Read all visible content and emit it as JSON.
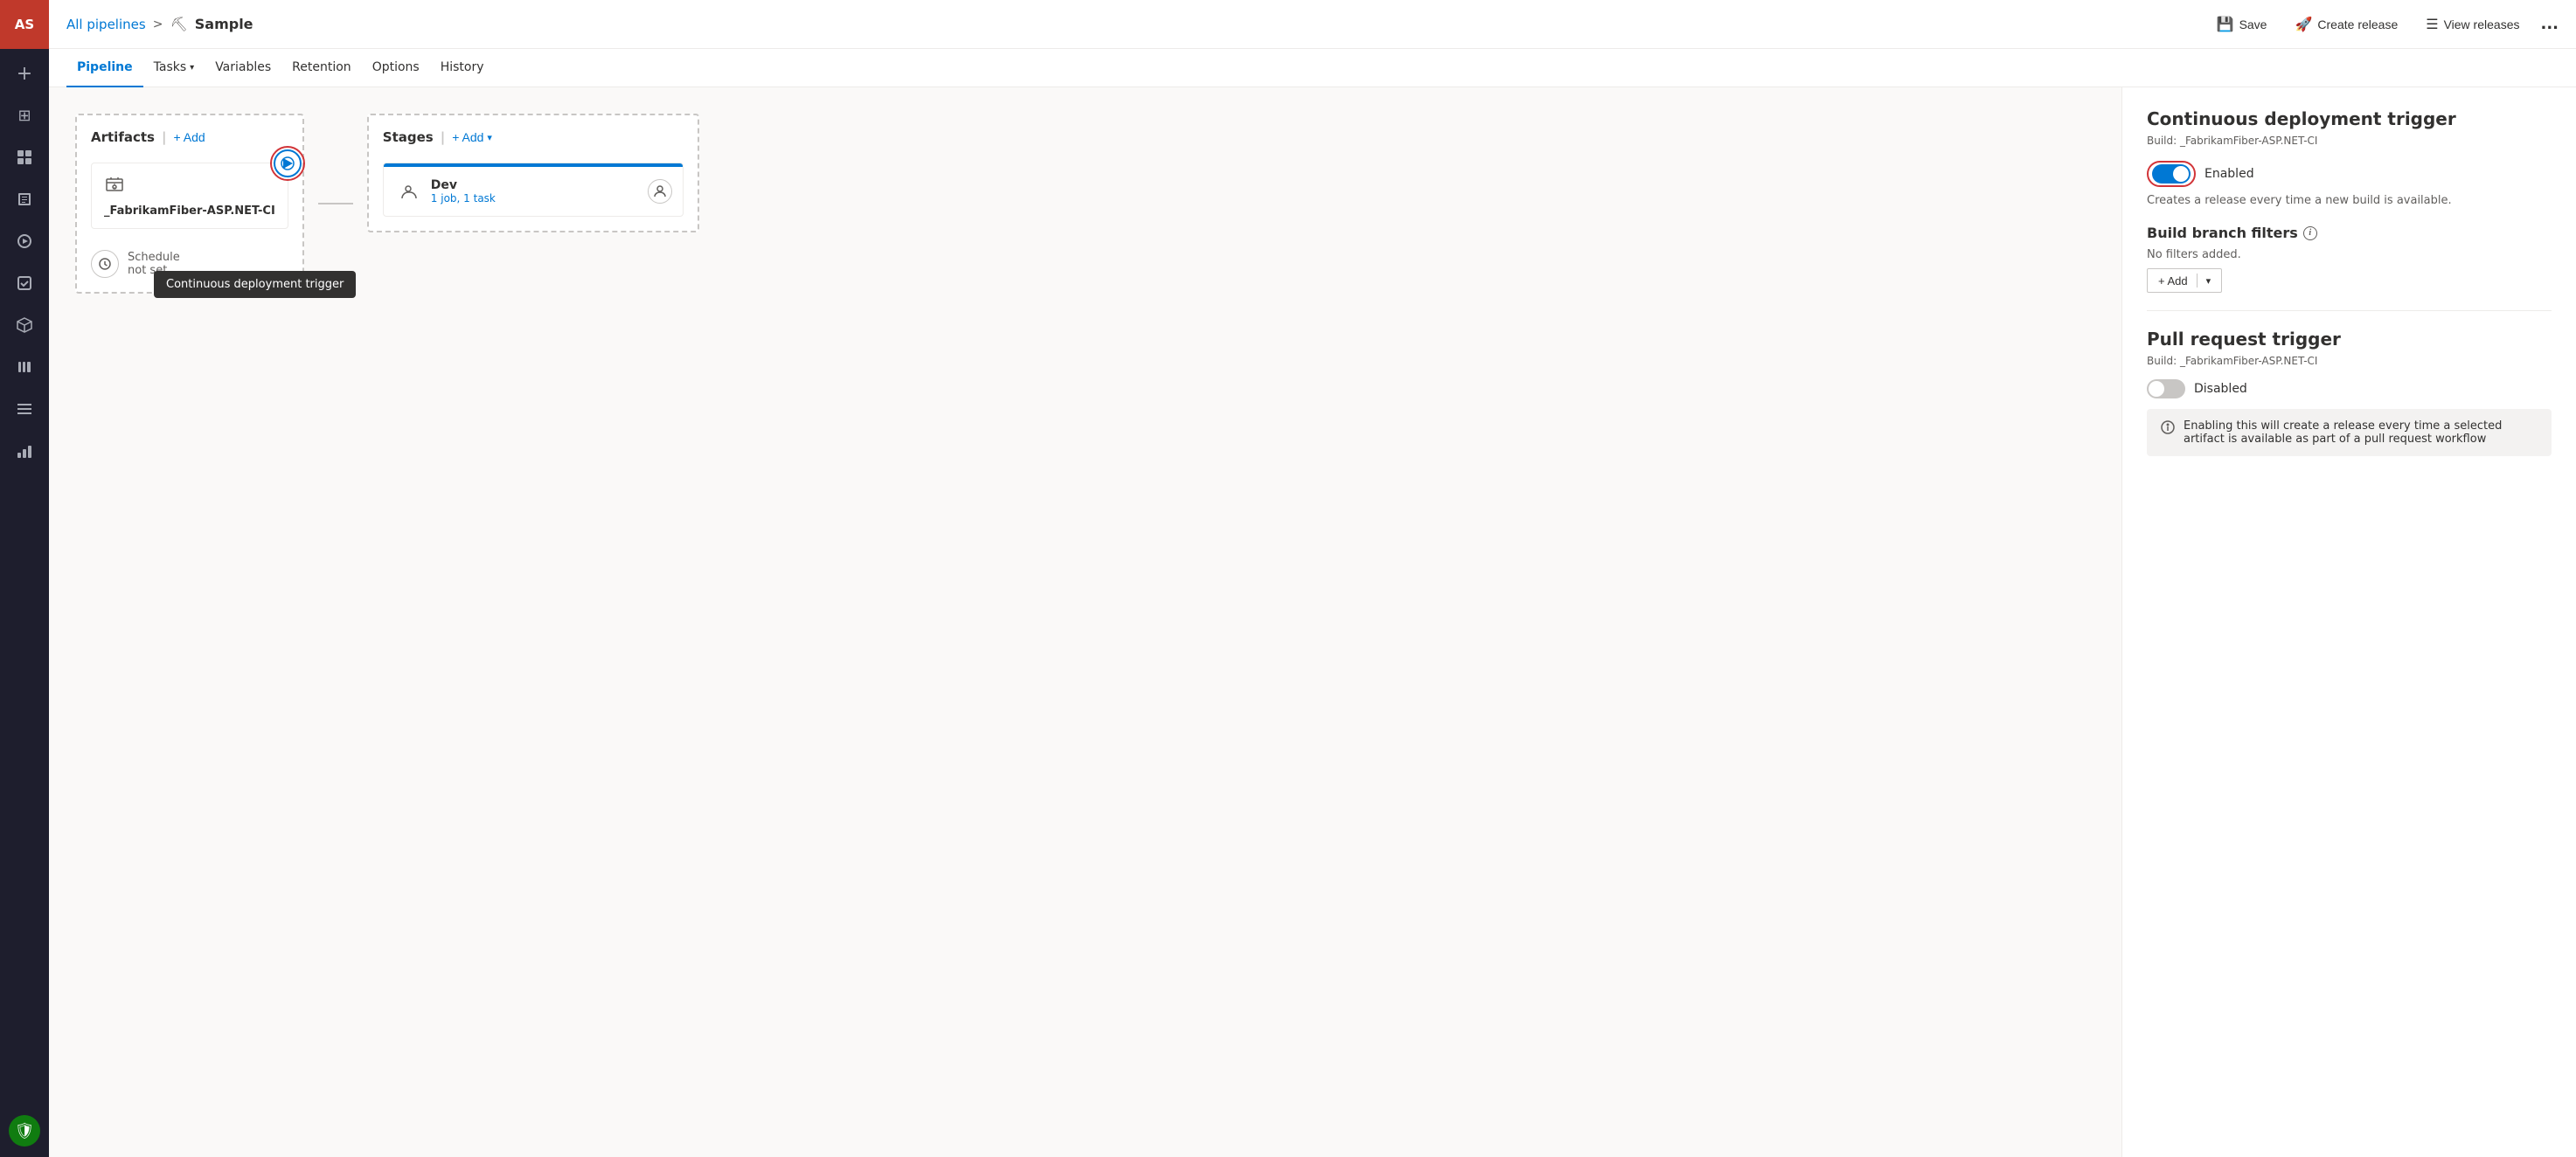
{
  "sidebar": {
    "avatar": "AS",
    "icons": [
      {
        "name": "plus-icon",
        "glyph": "+"
      },
      {
        "name": "home-icon",
        "glyph": "⊞"
      },
      {
        "name": "user-icon",
        "glyph": "👤"
      },
      {
        "name": "deploy-icon",
        "glyph": "🚀"
      },
      {
        "name": "build-icon",
        "glyph": "⚙"
      },
      {
        "name": "repos-icon",
        "glyph": "📄"
      },
      {
        "name": "pipelines-icon",
        "glyph": "▶"
      },
      {
        "name": "library-icon",
        "glyph": "📚"
      },
      {
        "name": "monitor-icon",
        "glyph": "🖥"
      },
      {
        "name": "ci-icon",
        "glyph": "⬆"
      }
    ],
    "security_icon": "🛡"
  },
  "topbar": {
    "breadcrumb_link": "All pipelines",
    "breadcrumb_sep": ">",
    "pipeline_icon": "⛏",
    "current_pipeline": "Sample",
    "save_label": "Save",
    "create_release_label": "Create release",
    "view_releases_label": "View releases",
    "more_label": "..."
  },
  "navtabs": {
    "items": [
      {
        "label": "Pipeline",
        "active": true
      },
      {
        "label": "Tasks",
        "has_arrow": true,
        "active": false
      },
      {
        "label": "Variables",
        "active": false
      },
      {
        "label": "Retention",
        "active": false
      },
      {
        "label": "Options",
        "active": false
      },
      {
        "label": "History",
        "active": false
      }
    ]
  },
  "canvas": {
    "artifacts_header": "Artifacts",
    "add_artifact_label": "+ Add",
    "stages_header": "Stages",
    "add_stage_label": "+ Add",
    "artifact": {
      "name": "_FabrikamFiber-ASP.NET-CI"
    },
    "trigger_tooltip": "Continuous deployment trigger",
    "schedule": {
      "label": "Schedule",
      "sublabel": "not set"
    },
    "stage": {
      "name": "Dev",
      "sub": "1 job, 1 task"
    }
  },
  "right_panel": {
    "cd_trigger": {
      "title": "Continuous deployment trigger",
      "subtitle": "Build: _FabrikamFiber-ASP.NET-CI",
      "toggle_state": "enabled",
      "toggle_label": "Enabled",
      "toggle_desc": "Creates a release every time a new build is available.",
      "branch_filters_title": "Build branch filters",
      "no_filters_label": "No filters added.",
      "add_label": "+ Add"
    },
    "pr_trigger": {
      "title": "Pull request trigger",
      "subtitle": "Build: _FabrikamFiber-ASP.NET-CI",
      "toggle_state": "disabled",
      "toggle_label": "Disabled",
      "info_text": "Enabling this will create a release every time a selected artifact is available as part of a pull request workflow"
    }
  }
}
